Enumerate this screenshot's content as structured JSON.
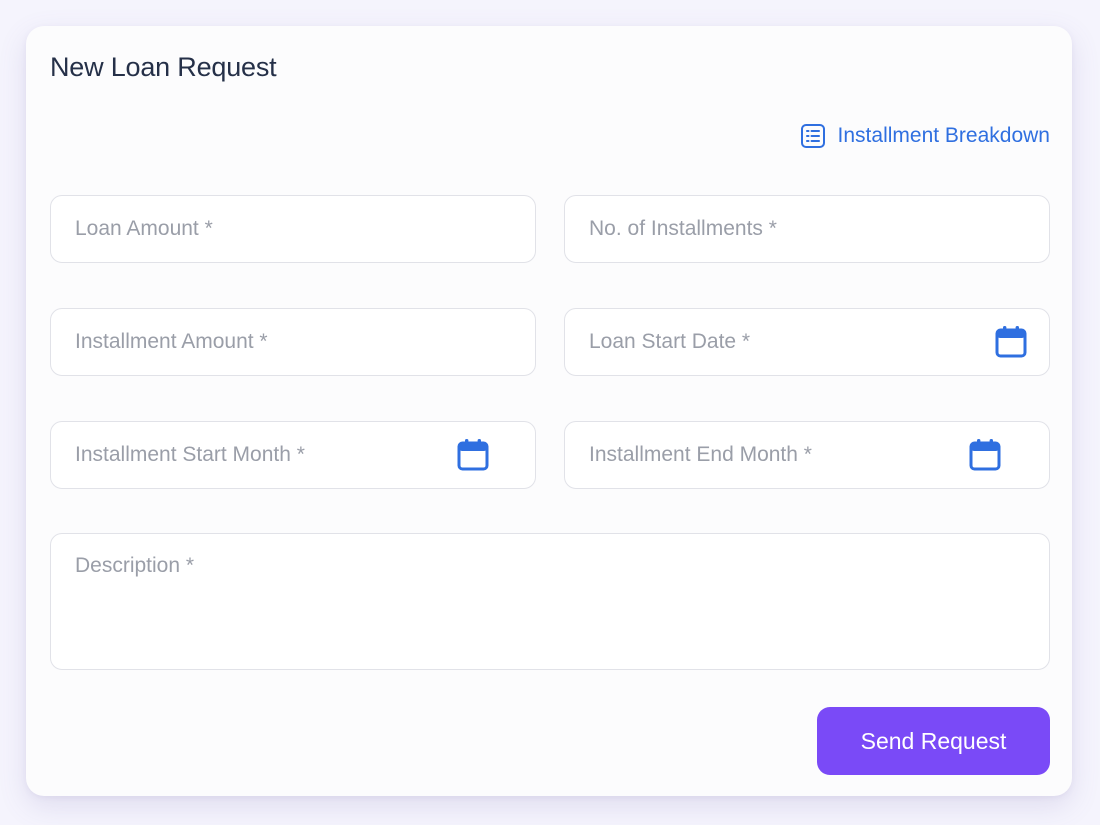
{
  "form": {
    "title": "New Loan Request",
    "breakdown_link": {
      "label": "Installment Breakdown",
      "icon": "list-icon"
    },
    "fields": {
      "loan_amount": {
        "placeholder": "Loan Amount *",
        "value": ""
      },
      "installments_count": {
        "placeholder": "No. of Installments *",
        "value": ""
      },
      "installment_amount": {
        "placeholder": "Installment Amount *",
        "value": ""
      },
      "loan_start_date": {
        "placeholder": "Loan Start Date *",
        "value": "",
        "icon": "calendar-icon"
      },
      "installment_start_month": {
        "placeholder": "Installment Start Month *",
        "value": "",
        "icon": "calendar-icon"
      },
      "installment_end_month": {
        "placeholder": "Installment End Month *",
        "value": "",
        "icon": "calendar-icon"
      },
      "description": {
        "placeholder": "Description *",
        "value": ""
      }
    },
    "submit_label": "Send Request"
  },
  "colors": {
    "accent": "#7a4af7",
    "link": "#2f6fe0",
    "icon": "#2f6fe0",
    "title": "#253048",
    "placeholder": "#9a9ea8",
    "border": "#e1e2e8",
    "background": "#f5f4fd"
  }
}
